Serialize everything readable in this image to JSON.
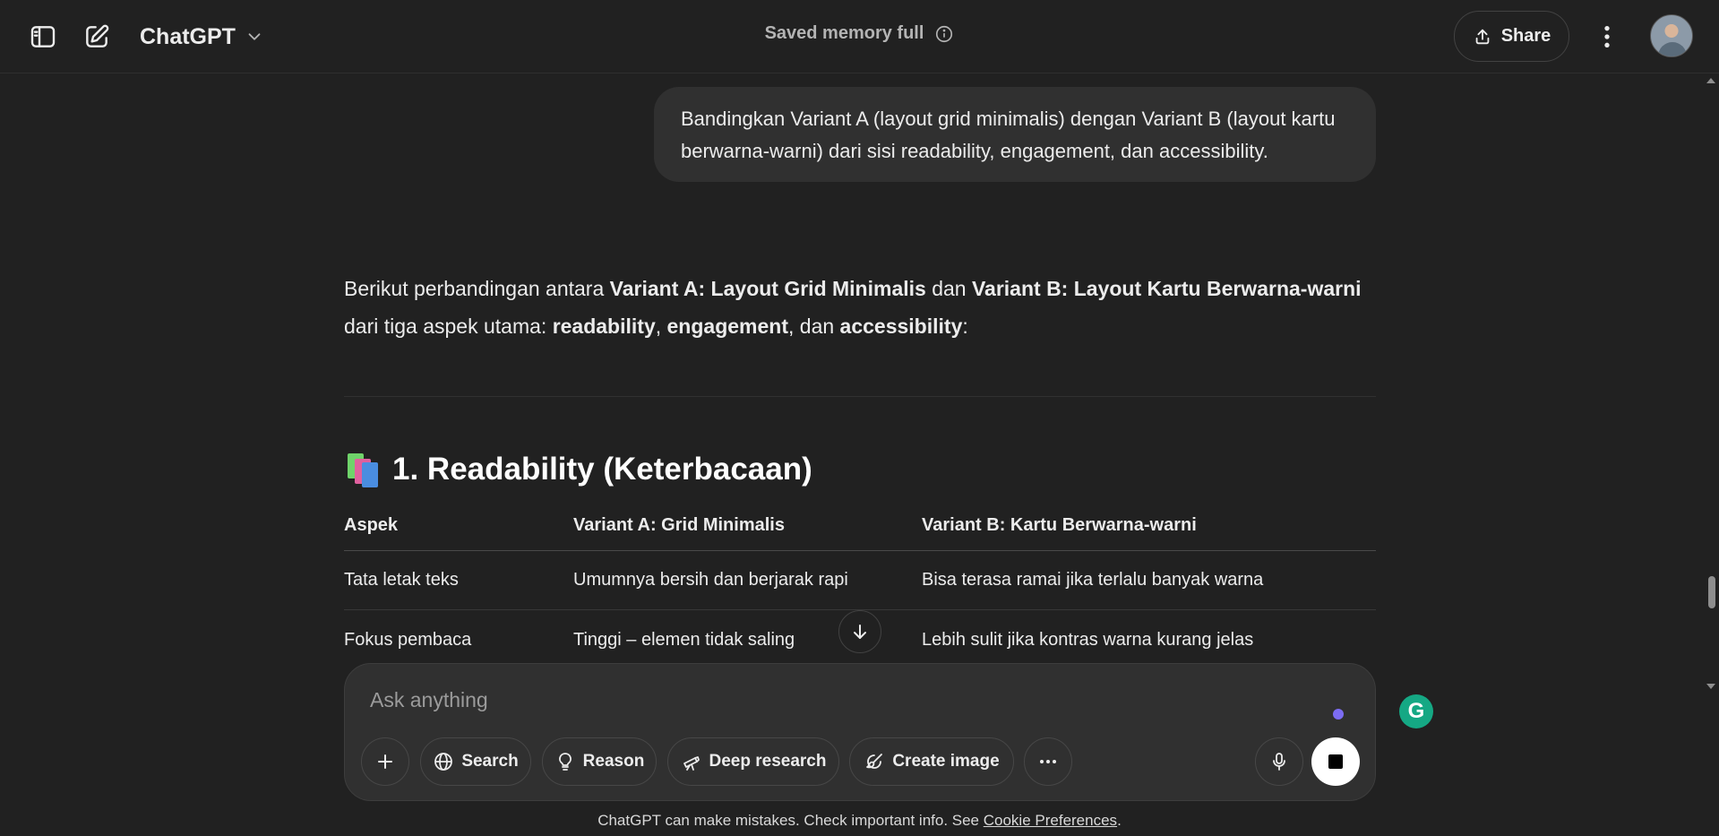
{
  "header": {
    "model_name": "ChatGPT",
    "memory_status": "Saved memory full",
    "share_label": "Share"
  },
  "conversation": {
    "user_message": "Bandingkan Variant A (layout grid minimalis) dengan Variant B (layout kartu berwarna-warni) dari sisi readability, engagement, dan accessibility.",
    "answer_intro": {
      "t1": "Berikut perbandingan antara ",
      "b1": "Variant A: Layout Grid Minimalis",
      "t2": " dan ",
      "b2": "Variant B: Layout Kartu Berwarna-warni",
      "t3": " dari tiga aspek utama: ",
      "b3": "readability",
      "t4": ", ",
      "b4": "engagement",
      "t5": ", dan ",
      "b5": "accessibility",
      "t6": ":"
    },
    "section_title": "1. Readability (Keterbacaan)",
    "table": {
      "headers": [
        "Aspek",
        "Variant A: Grid Minimalis",
        "Variant B: Kartu Berwarna-warni"
      ],
      "rows": [
        [
          "Tata letak teks",
          "Umumnya bersih dan berjarak rapi",
          "Bisa terasa ramai jika terlalu banyak warna"
        ],
        [
          "Fokus pembaca",
          "Tinggi – elemen tidak saling",
          "Lebih sulit jika kontras warna kurang jelas"
        ]
      ]
    }
  },
  "composer": {
    "placeholder": "Ask anything",
    "tools": {
      "search": "Search",
      "reason": "Reason",
      "deep_research": "Deep research",
      "create_image": "Create image"
    }
  },
  "footer": {
    "note": "ChatGPT can make mistakes. Check important info. See ",
    "link": "Cookie Preferences",
    "end": "."
  },
  "grammarly_letter": "G",
  "colors": {
    "background": "#212121",
    "bubble": "#303030",
    "accent_dot": "#7c6cf2",
    "grammarly": "#15a884"
  }
}
